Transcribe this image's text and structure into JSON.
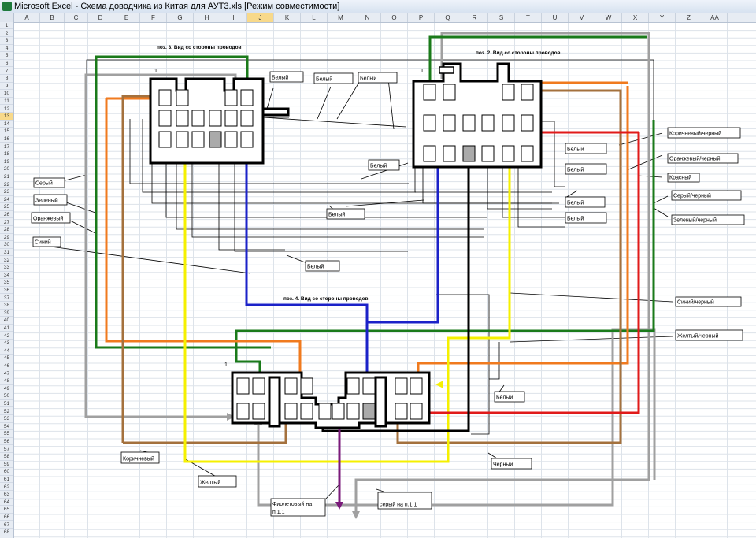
{
  "window": {
    "title": "Microsoft Excel - Схема доводчика из Китая для АУТ3.xls  [Режим совместимости]"
  },
  "sheet": {
    "columns": [
      "A",
      "B",
      "C",
      "D",
      "E",
      "F",
      "G",
      "H",
      "I",
      "J",
      "K",
      "L",
      "M",
      "N",
      "O",
      "P",
      "Q",
      "R",
      "S",
      "T",
      "U",
      "V",
      "W",
      "X",
      "Y",
      "Z",
      "AA"
    ],
    "selected_column": "J",
    "row_count": 68,
    "selected_row": "13"
  },
  "diagram": {
    "headings": {
      "pos3": "поз. 3. Вид со стороны проводов",
      "pos2": "поз. 2. Вид со стороны проводов",
      "pos4": "поз. 4. Вид со стороны проводов"
    },
    "pin1_markers": [
      "1",
      "1",
      "1"
    ],
    "labels": {
      "belyi_1": "Белый",
      "belyi_2": "Белый",
      "belyi_3": "Белый",
      "belyi_4": "Белый",
      "belyi_5": "Белый",
      "belyi_6": "Белый",
      "belyi_7": "Белый",
      "belyi_8": "Белый",
      "belyi_9": "Белый",
      "belyi_10": "Белый",
      "belyi_11": "Белый",
      "seryi": "Серый",
      "zelenyi": "Зеленый",
      "oranzhevyi": "Оранжевый",
      "sinii": "Синий",
      "korichnevyi": "Коричневый",
      "zheltyi": "Желтый",
      "fioletovyi": "Фиолетовый на п.1.1",
      "seryi_p11": "серый на п.1.1",
      "chernyi": "Черный",
      "korichnevyi_chernyi": "Коричневый/черный",
      "oranzhevyi_chernyi": "Оранжевый/черный",
      "krasnyi": "Красный",
      "seryi_chernyi": "Серый/черный",
      "zelenyi_chernyi": "Зеленый/черный",
      "sinii_chernyi": "Синий/черный",
      "zheltyi_chernyi": "Желтый/черный"
    },
    "wire_colors": {
      "green": "#1a7a1a",
      "orange": "#f07a1e",
      "brown": "#a4713d",
      "blue": "#1b22c8",
      "yellow": "#f5f000",
      "gray": "#a0a0a0",
      "red": "#e01a1a",
      "black": "#000000",
      "violet": "#7a1a7a"
    }
  }
}
